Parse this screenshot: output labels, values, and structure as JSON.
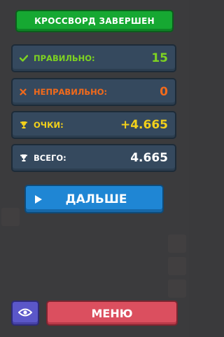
{
  "title": "КРОССВОРД ЗАВЕРШЕН",
  "stats": {
    "correct": {
      "label": "ПРАВИЛЬНО:",
      "value": "15",
      "icon": "check-icon",
      "color": "#7ed321"
    },
    "wrong": {
      "label": "НЕПРАВИЛЬНО:",
      "value": "0",
      "icon": "cross-icon",
      "color": "#f26a1b"
    },
    "points": {
      "label": "ОЧКИ:",
      "value": "+4.665",
      "icon": "trophy-icon",
      "color": "#f2d01b"
    },
    "total": {
      "label": "ВСЕГО:",
      "value": "4.665",
      "icon": "trophy-icon",
      "color": "#ffffff"
    }
  },
  "buttons": {
    "next_label": "ДАЛЬШЕ",
    "menu_label": "МЕНЮ",
    "eye_icon": "eye-icon"
  },
  "colors": {
    "banner": "#16a832",
    "row": "#35495e",
    "next": "#1f86d4",
    "menu": "#db4f5f",
    "eye": "#5b57c9"
  }
}
